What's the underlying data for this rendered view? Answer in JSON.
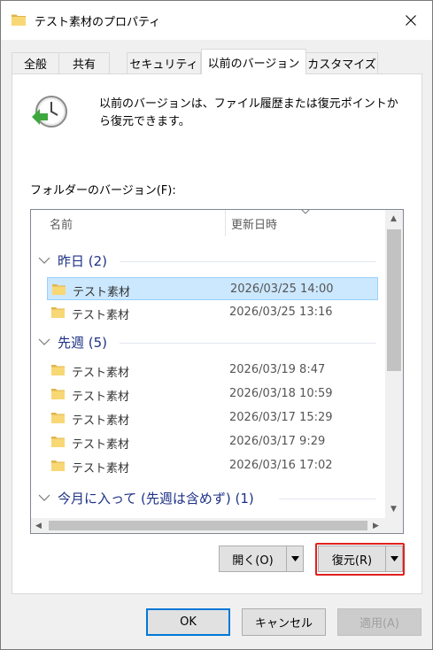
{
  "window": {
    "title": "テスト素材のプロパティ",
    "close_glyph": "✕"
  },
  "tabs": [
    {
      "label": "全般",
      "active": false
    },
    {
      "label": "共有",
      "active": false
    },
    {
      "label": "セキュリティ",
      "active": false
    },
    {
      "label": "以前のバージョン",
      "active": true
    },
    {
      "label": "カスタマイズ",
      "active": false
    }
  ],
  "panel": {
    "description": "以前のバージョンは、ファイル履歴または復元ポイントから復元できます。",
    "folder_versions_label": "フォルダーのバージョン(F):",
    "columns": {
      "name": "名前",
      "date": "更新日時"
    },
    "groups": [
      {
        "label": "昨日 (2)"
      },
      {
        "label": "先週 (5)"
      },
      {
        "label": "今月に入って (先週は含めず) (1)"
      }
    ],
    "rows": [
      {
        "name": "テスト素材",
        "date": "2026/03/25 14:00",
        "selected": true
      },
      {
        "name": "テスト素材",
        "date": "2026/03/25 13:16",
        "selected": false
      },
      {
        "name": "テスト素材",
        "date": "2026/03/19 8:47",
        "selected": false
      },
      {
        "name": "テスト素材",
        "date": "2026/03/18 10:59",
        "selected": false
      },
      {
        "name": "テスト素材",
        "date": "2026/03/17 15:29",
        "selected": false
      },
      {
        "name": "テスト素材",
        "date": "2026/03/17 9:29",
        "selected": false
      },
      {
        "name": "テスト素材",
        "date": "2026/03/16 17:02",
        "selected": false
      }
    ],
    "open_button": "開く(O)",
    "restore_button": "復元(R)"
  },
  "footer": {
    "ok": "OK",
    "cancel": "キャンセル",
    "apply": "適用(A)"
  },
  "colors": {
    "group_text": "#1e3287",
    "selection_bg": "#cce8ff",
    "highlight": "#e02020",
    "folder": "#f8d775"
  }
}
